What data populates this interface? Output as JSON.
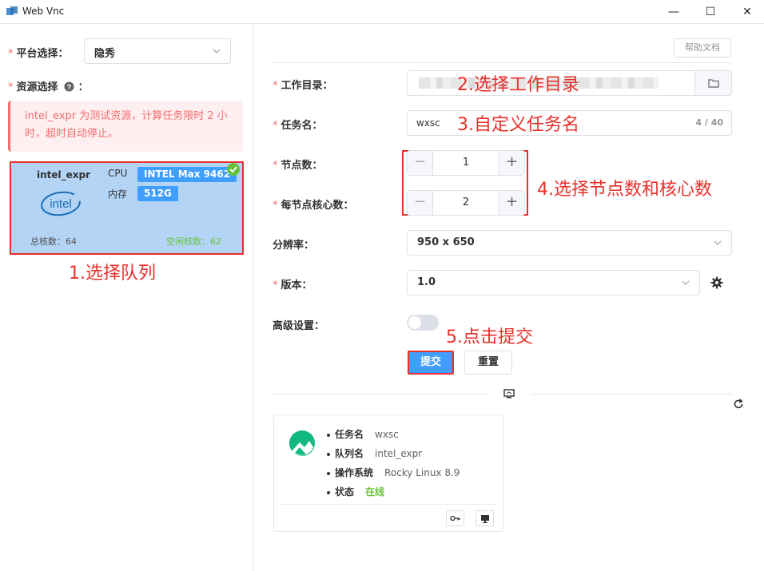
{
  "window": {
    "title": "Web Vnc",
    "controls": [
      "—",
      "☐",
      "✕"
    ]
  },
  "left": {
    "platform_label": "平台选择：",
    "platform_value": "隐秀",
    "resource_label": "资源选择",
    "resource_colon": "：",
    "alert_text": "intel_expr 为测试资源，计算任务限时 2 小时，超时自动停止。",
    "resource_card": {
      "name": "intel_expr",
      "cpu_key": "CPU",
      "cpu_value": "INTEL Max 9462",
      "mem_key": "内存",
      "mem_value": "512G",
      "logo_text": "intel",
      "total_cores": "总核数：64",
      "free_cores": "空闲核数：62"
    },
    "annotation": "1.选择队列"
  },
  "right": {
    "help_button": "帮助文档",
    "workdir_label": "工作目录：",
    "jobname_label": "任务名：",
    "jobname_value": "wxsc",
    "jobname_count": "4 / 40",
    "nodes_label": "节点数：",
    "nodes_value": "1",
    "cores_label": "每节点核心数：",
    "cores_value": "2",
    "resolution_label": "分辨率：",
    "resolution_value": "950 x 650",
    "version_label": "版本：",
    "version_value": "1.0",
    "advanced_label": "高级设置：",
    "advanced_enabled": false,
    "submit_button": "提交",
    "reset_button": "重置",
    "annotations": {
      "workdir": "2.选择工作目录",
      "jobname": "3.自定义任务名",
      "nodes": "4.选择节点数和核心数",
      "submit": "5.点击提交"
    },
    "job_card": {
      "rows": [
        {
          "key": "任务名",
          "value": "wxsc"
        },
        {
          "key": "队列名",
          "value": "intel_expr"
        },
        {
          "key": "操作系统",
          "value": "Rocky Linux 8.9"
        },
        {
          "key": "状态",
          "value": "在线"
        }
      ]
    }
  },
  "colors": {
    "primary": "#409eff",
    "danger": "#f56c6c",
    "success": "#67c23a",
    "annotation": "#e8302b",
    "selected_card": "#b3d4f5"
  },
  "icons": [
    "app-icon",
    "chevron-down-icon",
    "question-icon",
    "check-icon",
    "folder-icon",
    "gear-icon",
    "screen-icon",
    "refresh-icon",
    "key-icon",
    "monitor-icon",
    "rocky-logo"
  ]
}
